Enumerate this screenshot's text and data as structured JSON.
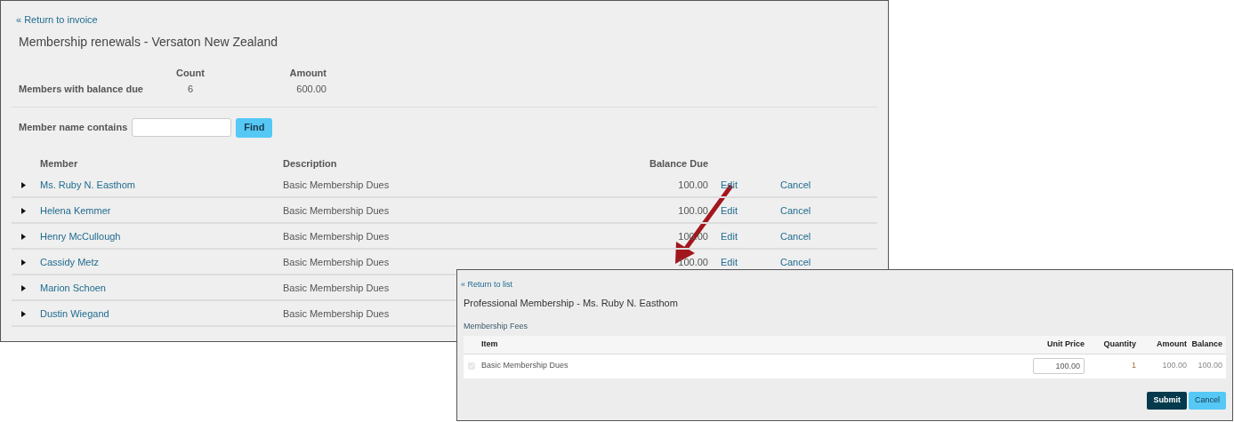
{
  "main_window": {
    "back_link": "« Return to invoice",
    "title": "Membership renewals - Versaton New Zealand",
    "summary": {
      "columns": [
        "Count",
        "Amount"
      ],
      "rows": [
        {
          "label": "Members with balance due",
          "count": "6",
          "amount": "600.00"
        }
      ]
    },
    "filter": {
      "label": "Member name contains",
      "button": "Find"
    },
    "table": {
      "columns": [
        "Member",
        "Description",
        "Balance Due"
      ],
      "rows": [
        {
          "expanded": false,
          "member": "Ms. Ruby N. Easthom",
          "description": "Basic Membership Dues",
          "balance_due": "100.00",
          "edit": "Edit",
          "cancel": "Cancel"
        },
        {
          "expanded": false,
          "member": "Helena Kemmer",
          "description": "Basic Membership Dues",
          "balance_due": "100.00",
          "edit": "Edit",
          "cancel": "Cancel"
        },
        {
          "expanded": false,
          "member": "Henry McCullough",
          "description": "Basic Membership Dues",
          "balance_due": "100.00",
          "edit": "Edit",
          "cancel": "Cancel"
        },
        {
          "expanded": false,
          "member": "Cassidy Metz",
          "description": "Basic Membership Dues",
          "balance_due": "100.00",
          "edit": "Edit",
          "cancel": "Cancel"
        },
        {
          "expanded": false,
          "member": "Marion Schoen",
          "description": "Basic Membership Dues"
        },
        {
          "expanded": false,
          "member": "Dustin Wiegand",
          "description": "Basic Membership Dues"
        }
      ]
    }
  },
  "detail_window": {
    "back_link": "« Return to list",
    "title": "Professional Membership - Ms. Ruby N. Easthom",
    "section": "Membership Fees",
    "table": {
      "columns": [
        "Item",
        "Unit Price",
        "Quantity",
        "Amount",
        "Balance"
      ],
      "rows": [
        {
          "checked": true,
          "disabled": true,
          "item": "Basic Membership Dues",
          "unit_price": "100.00",
          "quantity": "1",
          "amount": "100.00",
          "balance": "100.00"
        }
      ]
    },
    "buttons": [
      {
        "label": "Submit",
        "kind": "primary"
      },
      {
        "label": "Cancel",
        "kind": "secondary"
      }
    ]
  }
}
